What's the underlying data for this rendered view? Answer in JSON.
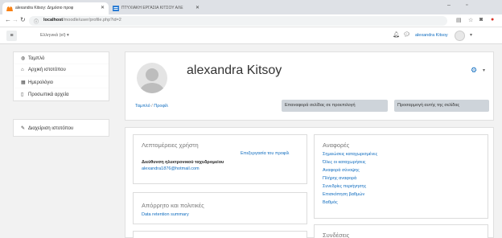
{
  "browser": {
    "tabs": [
      {
        "title": "alexandra Kitsoy: Δημόσιο προφ",
        "active": true
      },
      {
        "title": "ΠΤΥΧΙΑΚΗ ΕΡΓΑΣΙΑ ΚΙΤΣΟΥ ΑΛΕ",
        "active": false
      }
    ],
    "address": {
      "host": "localhost",
      "path": "/moodle/user/profile.php?id=2"
    }
  },
  "navbar": {
    "language": "Ελληνικά (el) ▾",
    "username": "alexandra Kitsoy"
  },
  "sidebar": {
    "items": [
      {
        "icon": "tachometer-icon",
        "glyph": "◍",
        "label": "Ταμπλό"
      },
      {
        "icon": "home-icon",
        "glyph": "⌂",
        "label": "Αρχική ιστοτόπου"
      },
      {
        "icon": "calendar-icon",
        "glyph": "▦",
        "label": "Ημερολόγιο"
      },
      {
        "icon": "file-icon",
        "glyph": "▯",
        "label": "Προσωπικά αρχεία"
      }
    ],
    "admin": {
      "icon": "wrench-icon",
      "glyph": "✎",
      "label": "Διαχείριση ιστοτόπου"
    }
  },
  "header": {
    "fullname": "alexandra Kitsoy",
    "breadcrumb": [
      "Ταμπλό",
      "Προφίλ"
    ],
    "reset_button": "Επαναφορά σελίδας σε προεπιλογή",
    "customise_button": "Προσαρμογή αυτής της σελίδας"
  },
  "user_details": {
    "title": "Λεπτομέρειες χρήστη",
    "edit_profile": "Επεξεργασία του προφίλ",
    "email_label": "Διεύθυνση ηλεκτρονικού ταχυδρομείου",
    "email_value": "alexandra1876@hotmail.com"
  },
  "privacy": {
    "title": "Απόρρητο και πολιτικές",
    "link": "Data retention summary"
  },
  "reports": {
    "title": "Αναφορές",
    "links": [
      "Σημειώσεις καταχωρισμένες",
      "Όλες οι καταχωρήσεις",
      "Αναφορά σύνοψης",
      "Πλήρης αναφορά",
      "Συνεδρίες περιήγησης",
      "Επισκόπηση βαθμών",
      "Βαθμός"
    ]
  },
  "login_activity": {
    "title": "Συνδέσεις"
  },
  "colors": {
    "link": "#0f6cbf",
    "button": "#ced4da",
    "page_bg": "#f2f2f2"
  }
}
